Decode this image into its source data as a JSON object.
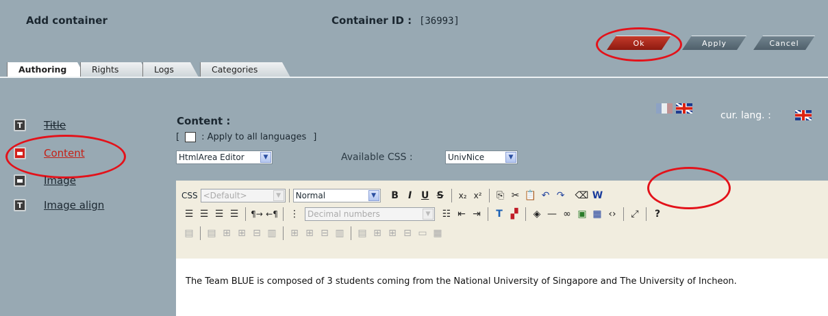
{
  "header": {
    "title": "Add container",
    "container_id_label": "Container ID :",
    "container_id_value": "[36993]"
  },
  "actions": {
    "ok": "Ok",
    "apply": "Apply",
    "cancel": "Cancel"
  },
  "tabs": [
    "Authoring",
    "Rights",
    "Logs",
    "Categories"
  ],
  "language": {
    "current_label": "cur. lang. :"
  },
  "sidebar": {
    "items": [
      {
        "label": "Title",
        "icon": "text-icon"
      },
      {
        "label": "Content",
        "icon": "content-icon"
      },
      {
        "label": "Image",
        "icon": "image-icon"
      },
      {
        "label": "Image align",
        "icon": "text-icon"
      }
    ]
  },
  "content": {
    "title": "Content :",
    "apply_all_label": ": Apply to all languages",
    "editor_select": "HtmlArea Editor",
    "css_label": "Available CSS :",
    "css_select": "UnivNice"
  },
  "toolbar": {
    "css_label": "CSS",
    "css_class_select": "<Default>",
    "format_select": "Normal",
    "list_select": "Decimal numbers",
    "help": "?"
  },
  "editor": {
    "text": "The Team BLUE is composed of 3 students coming from the National University of Singapore and The University of Incheon."
  },
  "colors": {
    "ok_button": "#b3281c",
    "highlight": "#e3121a",
    "link_active": "#c42016"
  }
}
